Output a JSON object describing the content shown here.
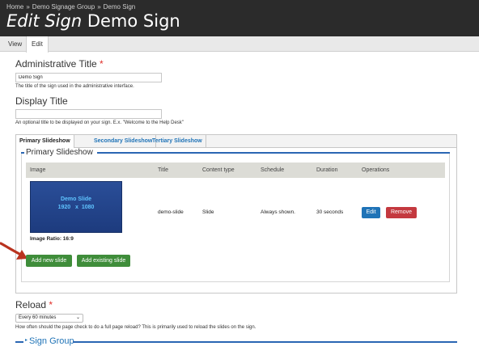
{
  "header": {
    "breadcrumb": [
      "Home",
      "Demo Signage Group",
      "Demo Sign"
    ],
    "breadcrumb_sep": "»",
    "title_em": "Edit Sign",
    "title_rest": "Demo Sign"
  },
  "primary_tabs": [
    {
      "label": "View",
      "active": false
    },
    {
      "label": "Edit",
      "active": true
    }
  ],
  "form": {
    "admin_title": {
      "label": "Administrative Title",
      "required_mark": "*",
      "value": "Demo Sign",
      "description": "The title of the sign used in the administrative interface."
    },
    "display_title": {
      "label": "Display Title",
      "value": "",
      "description": "An optional title to be displayed on your sign. E.x. \"Welcome to the Help Desk\""
    },
    "vertical_tabs": [
      {
        "label": "Primary Slideshow",
        "active": true
      },
      {
        "label": "Secondary Slideshow",
        "active": false
      },
      {
        "label": "Tertiary Slideshow",
        "active": false
      }
    ],
    "fieldset_legend": "Primary Slideshow",
    "table": {
      "headers": [
        "Image",
        "Title",
        "Content type",
        "Schedule",
        "Duration",
        "Operations"
      ],
      "row": {
        "thumb_title": "Demo Slide",
        "thumb_size_w": "1920",
        "thumb_size_x": "x",
        "thumb_size_h": "1080",
        "image_ratio": "Image Ratio: 16:9",
        "title": "demo-slide",
        "content_type": "Slide",
        "schedule": "Always shown.",
        "duration": "30 seconds",
        "edit_label": "Edit",
        "remove_label": "Remove"
      }
    },
    "add_new_label": "Add new slide",
    "add_existing_label": "Add existing slide",
    "reload": {
      "label": "Reload",
      "required_mark": "*",
      "selected": "Every 60 minutes",
      "description": "How often should the page check to do a full page reload? This is primarily used to reload the slides on the sign."
    },
    "sign_group_label": "Sign Group"
  },
  "colors": {
    "header_bg": "#2b2b2b",
    "link_blue": "#1f73b7",
    "remove_red": "#c4393f",
    "add_green": "#3f8d3a",
    "annotation_arrow": "#b9331f"
  }
}
